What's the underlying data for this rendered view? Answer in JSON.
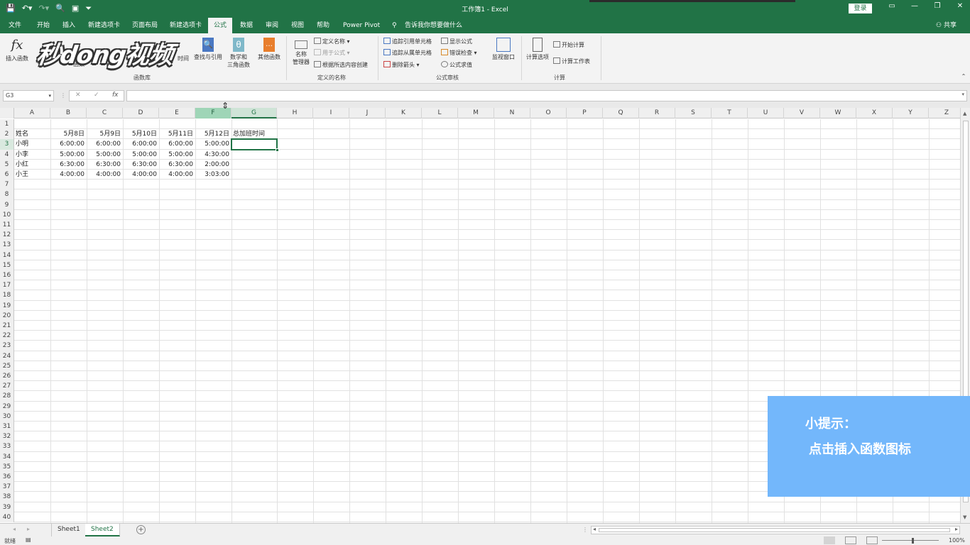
{
  "titlebar": {
    "title": "工作簿1 - Excel",
    "login_label": "登录",
    "save_icon": "save-icon",
    "undo_icon": "undo-icon"
  },
  "tabs": [
    {
      "label": "文件",
      "active": false
    },
    {
      "label": "开始",
      "active": false
    },
    {
      "label": "插入",
      "active": false
    },
    {
      "label": "新建选项卡",
      "active": false
    },
    {
      "label": "页面布局",
      "active": false
    },
    {
      "label": "新建选项卡",
      "active": false
    },
    {
      "label": "公式",
      "active": true
    },
    {
      "label": "数据",
      "active": false
    },
    {
      "label": "审阅",
      "active": false
    },
    {
      "label": "视图",
      "active": false
    },
    {
      "label": "帮助",
      "active": false
    },
    {
      "label": "Power Pivot",
      "active": false
    }
  ],
  "tell_me": "告诉我你想要做什么",
  "share_label": "共享",
  "ribbon": {
    "insert_function": "插入函数",
    "function_group_label": "函数",
    "datetime_label": "时间",
    "lookup_label": "查找与引用",
    "math_label_1": "数学和",
    "math_label_2": "三角函数",
    "other_label": "其他函数",
    "function_library": "函数库",
    "name_manager_1": "名称",
    "name_manager_2": "管理器",
    "define_name": "定义名称",
    "use_in_formula": "用于公式",
    "create_from_selection": "根据所选内容创建",
    "defined_names": "定义的名称",
    "trace_precedents": "追踪引用单元格",
    "trace_dependents": "追踪从属单元格",
    "remove_arrows": "删除箭头",
    "show_formulas": "显示公式",
    "error_checking": "错误检查",
    "evaluate_formula": "公式求值",
    "formula_auditing": "公式审核",
    "watch_window": "监视窗口",
    "calc_options": "计算选项",
    "calc_now": "开始计算",
    "calc_sheet": "计算工作表",
    "calculation": "计算"
  },
  "watermark": "秒dong视频",
  "formula_bar": {
    "name_box": "G3",
    "cancel": "✕",
    "enter": "✓",
    "fx": "fx",
    "value": ""
  },
  "columns": [
    "A",
    "B",
    "C",
    "D",
    "E",
    "F",
    "G",
    "H",
    "I",
    "J",
    "K",
    "L",
    "M",
    "N",
    "O",
    "P",
    "Q",
    "R",
    "S",
    "T",
    "U",
    "V",
    "W",
    "X",
    "Y",
    "Z"
  ],
  "selected_cell": "G3",
  "table": {
    "header": [
      "姓名",
      "5月8日",
      "5月9日",
      "5月10日",
      "5月11日",
      "5月12日",
      "总加班时间"
    ],
    "rows": [
      [
        "小明",
        "6:00:00",
        "6:00:00",
        "6:00:00",
        "6:00:00",
        "5:00:00"
      ],
      [
        "小李",
        "5:00:00",
        "5:00:00",
        "5:00:00",
        "5:00:00",
        "4:30:00"
      ],
      [
        "小红",
        "6:30:00",
        "6:30:00",
        "6:30:00",
        "6:30:00",
        "2:00:00"
      ],
      [
        "小王",
        "4:00:00",
        "4:00:00",
        "4:00:00",
        "4:00:00",
        "3:03:00"
      ]
    ]
  },
  "row_count": 40,
  "sheets": [
    {
      "label": "Sheet1",
      "active": false
    },
    {
      "label": "Sheet2",
      "active": true
    }
  ],
  "tip": {
    "title": "小提示：",
    "text": "点击插入函数图标"
  },
  "status": {
    "ready": "就绪",
    "zoom": "100%"
  },
  "colors": {
    "excel_green": "#217346",
    "tip_blue": "#73b7fb"
  }
}
